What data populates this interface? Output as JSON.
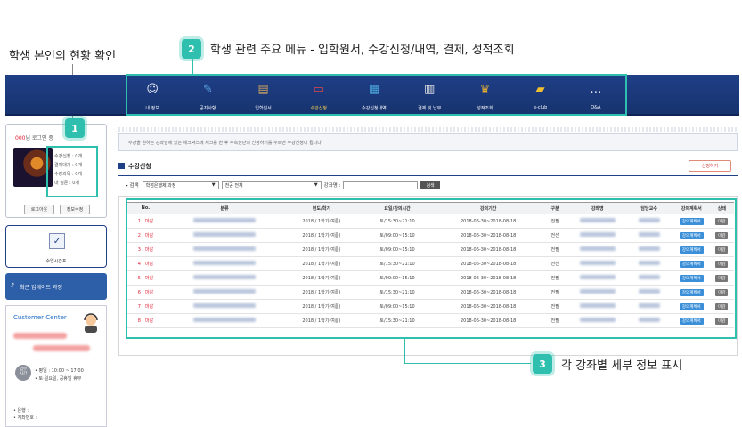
{
  "annotations": {
    "left_label": "학생 본인의 현황 확인",
    "top_label": "학생 관련 주요 메뉴 - 입학원서, 수강신청/내역, 결제, 성적조회",
    "bottom_label": "각 강좌별 세부 정보 표시",
    "badge1": "1",
    "badge2": "2",
    "badge3": "3",
    "accent_color": "#2ebfae"
  },
  "nav": {
    "items": [
      {
        "label": "내 정보",
        "icon": "user-chat-icon",
        "glyph": "☺",
        "color": "#e9eef8"
      },
      {
        "label": "공지사항",
        "icon": "notice-icon",
        "glyph": "✎",
        "color": "#5aa0e0"
      },
      {
        "label": "입학원서",
        "icon": "application-icon",
        "glyph": "▤",
        "color": "#c9a060"
      },
      {
        "label": "수강신청",
        "icon": "enroll-icon",
        "glyph": "▭",
        "color": "#e04848"
      },
      {
        "label": "수강신청내역",
        "icon": "history-icon",
        "glyph": "▦",
        "color": "#4aa0d8"
      },
      {
        "label": "결제 및 납부",
        "icon": "calendar-icon",
        "glyph": "▥",
        "color": "#e8e8e8"
      },
      {
        "label": "성적조회",
        "icon": "trophy-icon",
        "glyph": "♛",
        "color": "#e8b030"
      },
      {
        "label": "e-club",
        "icon": "folder-icon",
        "glyph": "▰",
        "color": "#f0c030"
      },
      {
        "label": "Q&A",
        "icon": "qa-icon",
        "glyph": "…",
        "color": "#e9eef8"
      }
    ],
    "active_index": 3
  },
  "login": {
    "name": "000",
    "suffix": "님 로그인 중",
    "stats": [
      "수강신청 : 0개",
      "결제대기 : 0개",
      "수강과목 : 0개",
      "내 질문 : 0개"
    ],
    "logout_label": "로그아웃",
    "edit_label": "정보수정"
  },
  "sidebar": {
    "timetable_label": "수업시간표",
    "update_label": "최근 업데이트 과정",
    "center_title": "Customer Center",
    "hours_badge": "업무\n시간",
    "hours_line1": "• 평일 : 10:00 ~ 17:00",
    "hours_line2": "• 토·일요일, 공휴일 휴무",
    "bank_label": "• 은행 :",
    "account_label": "• 계좌번호 :"
  },
  "notice": {
    "text": "수강을 원하는 강좌앞에 있는 체크박스에 체크를 한 후 추측상단의 신청하기를 누르면 수강신청이 됩니다."
  },
  "section": {
    "title": "수강신청",
    "apply_label": "신청하기"
  },
  "search": {
    "label": "검색",
    "select1": "학점은행제 과정",
    "select2": "전공 전체",
    "course_label": "강좌명 :",
    "button": "검색"
  },
  "table": {
    "headers": [
      "No.",
      "분류",
      "년도/학기",
      "요일/강의시간",
      "강의기간",
      "구분",
      "강좌명",
      "담당교수",
      "강의계획서",
      "상태"
    ],
    "rows": [
      {
        "no": "1 | 마감",
        "term": "2018 / 1학기(여름)",
        "time": "토/15:30~21:10",
        "period": "2018-06-30~2018-08-18",
        "type": "전필",
        "plan": "강의계획서",
        "status": "마감"
      },
      {
        "no": "2 | 마감",
        "term": "2018 / 1학기(여름)",
        "time": "토/09:00~15:10",
        "period": "2018-06-30~2018-08-18",
        "type": "전선",
        "plan": "강의계획서",
        "status": "마감"
      },
      {
        "no": "3 | 마감",
        "term": "2018 / 1학기(여름)",
        "time": "토/09:00~15:10",
        "period": "2018-06-30~2018-08-18",
        "type": "전필",
        "plan": "강의계획서",
        "status": "마감"
      },
      {
        "no": "4 | 마감",
        "term": "2018 / 1학기(여름)",
        "time": "토/15:30~21:10",
        "period": "2018-06-30~2018-08-18",
        "type": "전선",
        "plan": "강의계획서",
        "status": "마감"
      },
      {
        "no": "5 | 마감",
        "term": "2018 / 1학기(여름)",
        "time": "토/09:00~15:10",
        "period": "2018-06-30~2018-08-18",
        "type": "전필",
        "plan": "강의계획서",
        "status": "마감"
      },
      {
        "no": "6 | 마감",
        "term": "2018 / 1학기(여름)",
        "time": "토/15:30~21:10",
        "period": "2018-06-30~2018-08-18",
        "type": "전필",
        "plan": "강의계획서",
        "status": "마감"
      },
      {
        "no": "7 | 마감",
        "term": "2018 / 1학기(여름)",
        "time": "토/09:00~15:10",
        "period": "2018-06-30~2018-08-18",
        "type": "전필",
        "plan": "강의계획서",
        "status": "마감"
      },
      {
        "no": "8 | 마감",
        "term": "2018 / 1학기(여름)",
        "time": "토/15:30~21:10",
        "period": "2018-06-30~2018-08-18",
        "type": "전필",
        "plan": "강의계획서",
        "status": "마감"
      }
    ]
  }
}
